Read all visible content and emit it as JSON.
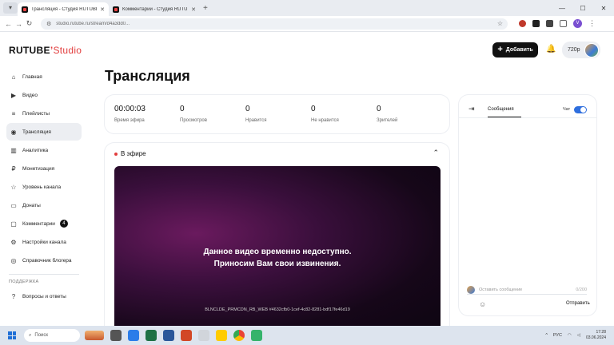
{
  "browser": {
    "tabs": [
      {
        "title": "Трансляция - Студия RUTUBE",
        "active": true
      },
      {
        "title": "Комментарии - Студия RUTUBE",
        "active": false
      }
    ],
    "new_tab": "+",
    "url": "studio.rutube.ru/stream/d4a3dd0...",
    "controls": {
      "minimize": "—",
      "maximize": "☐",
      "close": "✕"
    },
    "profile_initial": "V"
  },
  "header": {
    "logo_main": "RUTUBE",
    "logo_studio": "Studio",
    "add_button": "Добавить",
    "quality": "720p"
  },
  "sidebar": {
    "items": [
      {
        "label": "Главная",
        "icon": "⌂",
        "active": false
      },
      {
        "label": "Видео",
        "icon": "▶",
        "active": false
      },
      {
        "label": "Плейлисты",
        "icon": "≡",
        "active": false
      },
      {
        "label": "Трансляция",
        "icon": "◉",
        "active": true
      },
      {
        "label": "Аналитика",
        "icon": "▥",
        "active": false
      },
      {
        "label": "Монетизация",
        "icon": "₽",
        "active": false
      },
      {
        "label": "Уровень канала",
        "icon": "☆",
        "active": false
      },
      {
        "label": "Донаты",
        "icon": "▭",
        "active": false
      },
      {
        "label": "Комментарии",
        "icon": "▢",
        "active": false,
        "badge": "4"
      },
      {
        "label": "Настройки канала",
        "icon": "⚙",
        "active": false
      },
      {
        "label": "Справочник блогера",
        "icon": "◎",
        "active": false
      }
    ],
    "section_support": "ПОДДЕРЖКА",
    "support_items": [
      {
        "label": "Вопросы и ответы",
        "icon": "?"
      }
    ]
  },
  "main": {
    "title": "Трансляция",
    "stats": [
      {
        "value": "00:00:03",
        "label": "Время эфира"
      },
      {
        "value": "0",
        "label": "Просмотров"
      },
      {
        "value": "0",
        "label": "Нравится"
      },
      {
        "value": "0",
        "label": "Не нравится"
      },
      {
        "value": "0",
        "label": "Зрителей"
      }
    ],
    "live": {
      "label": "В эфире",
      "error_line1": "Данное видео временно недоступно.",
      "error_line2": "Приносим Вам свои извинения.",
      "error_code": "BLNCLDE_PRMCDN_RB_WEB #4632cfb0-1cef-4c82-8281-bdf17fe46d19"
    }
  },
  "chat": {
    "tab": "Сообщения",
    "toggle_label": "Чат",
    "input_placeholder": "Оставить сообщение",
    "counter": "0/200",
    "send": "Отправить"
  },
  "taskbar": {
    "search": "Поиск",
    "lang": "РУС",
    "time": "17:28",
    "date": "03.06.2024"
  },
  "colors": {
    "brand_red": "#e23c3c",
    "toggle_blue": "#2f6fde",
    "dark_button": "#111111"
  }
}
